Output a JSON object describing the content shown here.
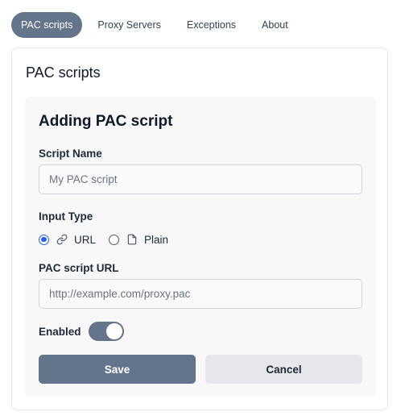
{
  "tabs": [
    {
      "label": "PAC scripts",
      "active": true
    },
    {
      "label": "Proxy Servers",
      "active": false
    },
    {
      "label": "Exceptions",
      "active": false
    },
    {
      "label": "About",
      "active": false
    }
  ],
  "card": {
    "title": "PAC scripts"
  },
  "form": {
    "title": "Adding PAC script",
    "script_name": {
      "label": "Script Name",
      "value": "",
      "placeholder": "My PAC script"
    },
    "input_type": {
      "label": "Input Type",
      "options": [
        {
          "label": "URL",
          "icon": "link-icon",
          "checked": true
        },
        {
          "label": "Plain",
          "icon": "file-icon",
          "checked": false
        }
      ]
    },
    "url": {
      "label": "PAC script URL",
      "value": "",
      "placeholder": "http://example.com/proxy.pac"
    },
    "enabled": {
      "label": "Enabled",
      "on": true
    },
    "save_label": "Save",
    "cancel_label": "Cancel"
  },
  "colors": {
    "accent": "#64748b",
    "radio_checked": "#2563eb",
    "panel_bg": "#f8f8f9",
    "secondary_button": "#e5e7eb"
  }
}
